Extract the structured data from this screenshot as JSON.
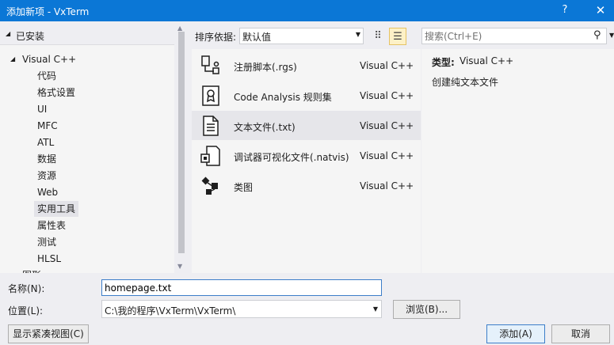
{
  "titlebar": {
    "title": "添加新项 - VxTerm",
    "help": "?",
    "close": "✕"
  },
  "tree": {
    "installed_label": "已安装",
    "root_label": "Visual C++",
    "children": [
      "代码",
      "格式设置",
      "UI",
      "MFC",
      "ATL",
      "数据",
      "资源",
      "Web",
      "实用工具",
      "属性表",
      "测试",
      "HLSL"
    ],
    "selected": "实用工具",
    "partial_next": "图形"
  },
  "sort": {
    "label": "排序依据:",
    "value": "默认值"
  },
  "search": {
    "placeholder": "搜索(Ctrl+E)"
  },
  "templates": [
    {
      "name": "注册脚本(.rgs)",
      "lang": "Visual C++",
      "icon": "registry-script-icon"
    },
    {
      "name": "Code Analysis 规则集",
      "lang": "Visual C++",
      "icon": "ruleset-icon"
    },
    {
      "name": "文本文件(.txt)",
      "lang": "Visual C++",
      "icon": "text-file-icon"
    },
    {
      "name": "调试器可视化文件(.natvis)",
      "lang": "Visual C++",
      "icon": "natvis-file-icon"
    },
    {
      "name": "类图",
      "lang": "Visual C++",
      "icon": "class-diagram-icon"
    }
  ],
  "selected_template": "文本文件(.txt)",
  "details": {
    "type_label": "类型:",
    "type_value": "Visual C++",
    "description": "创建纯文本文件"
  },
  "form": {
    "name_label": "名称(N):",
    "name_value": "homepage.txt",
    "location_label": "位置(L):",
    "location_value": "C:\\我的程序\\VxTerm\\VxTerm\\",
    "browse_label": "浏览(B)..."
  },
  "buttons": {
    "compact_view": "显示紧凑视图(C)",
    "add": "添加(A)",
    "cancel": "取消"
  },
  "colors": {
    "titlebar": "#0b77d6",
    "dialog_bg": "#eeeef2",
    "pane_bg": "#f5f5f5",
    "selection": "#e3e3e8",
    "accent_border": "#3c7ec9"
  }
}
